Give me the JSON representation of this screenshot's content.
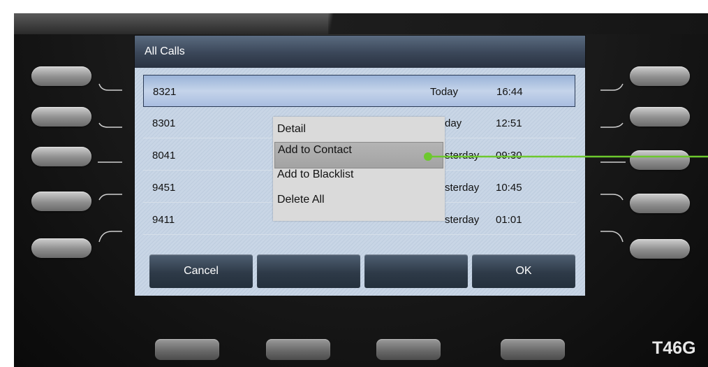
{
  "screen": {
    "title": "All Calls"
  },
  "calls": [
    {
      "number": "8321",
      "day": "Today",
      "time": "16:44",
      "selected": true
    },
    {
      "number": "8301",
      "day": "day",
      "time": "12:51"
    },
    {
      "number": "8041",
      "day": "sterday",
      "time": "09:30"
    },
    {
      "number": "9451",
      "day": "sterday",
      "time": "10:45"
    },
    {
      "number": "9411",
      "day": "sterday",
      "time": "01:01"
    }
  ],
  "menu": {
    "items": [
      "Detail",
      "Add to Contact",
      "Add to Blacklist",
      "Delete All"
    ],
    "highlighted_index": 1
  },
  "softkeys": {
    "cancel": "Cancel",
    "key2": "",
    "key3": "",
    "ok": "OK"
  },
  "phone": {
    "model": "T46G"
  },
  "colors": {
    "pointer": "#6dc82e",
    "header": "#3a4658",
    "selected_row": "#b0c3e3",
    "menu_bg": "#dadada"
  }
}
